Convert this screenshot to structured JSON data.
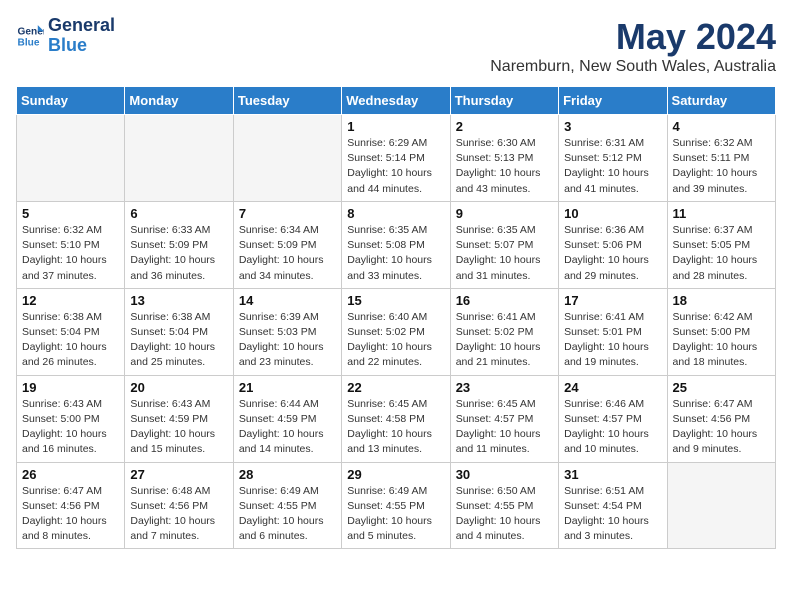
{
  "header": {
    "logo_line1": "General",
    "logo_line2": "Blue",
    "month_year": "May 2024",
    "location": "Naremburn, New South Wales, Australia"
  },
  "weekdays": [
    "Sunday",
    "Monday",
    "Tuesday",
    "Wednesday",
    "Thursday",
    "Friday",
    "Saturday"
  ],
  "weeks": [
    [
      {
        "day": "",
        "info": ""
      },
      {
        "day": "",
        "info": ""
      },
      {
        "day": "",
        "info": ""
      },
      {
        "day": "1",
        "info": "Sunrise: 6:29 AM\nSunset: 5:14 PM\nDaylight: 10 hours\nand 44 minutes."
      },
      {
        "day": "2",
        "info": "Sunrise: 6:30 AM\nSunset: 5:13 PM\nDaylight: 10 hours\nand 43 minutes."
      },
      {
        "day": "3",
        "info": "Sunrise: 6:31 AM\nSunset: 5:12 PM\nDaylight: 10 hours\nand 41 minutes."
      },
      {
        "day": "4",
        "info": "Sunrise: 6:32 AM\nSunset: 5:11 PM\nDaylight: 10 hours\nand 39 minutes."
      }
    ],
    [
      {
        "day": "5",
        "info": "Sunrise: 6:32 AM\nSunset: 5:10 PM\nDaylight: 10 hours\nand 37 minutes."
      },
      {
        "day": "6",
        "info": "Sunrise: 6:33 AM\nSunset: 5:09 PM\nDaylight: 10 hours\nand 36 minutes."
      },
      {
        "day": "7",
        "info": "Sunrise: 6:34 AM\nSunset: 5:09 PM\nDaylight: 10 hours\nand 34 minutes."
      },
      {
        "day": "8",
        "info": "Sunrise: 6:35 AM\nSunset: 5:08 PM\nDaylight: 10 hours\nand 33 minutes."
      },
      {
        "day": "9",
        "info": "Sunrise: 6:35 AM\nSunset: 5:07 PM\nDaylight: 10 hours\nand 31 minutes."
      },
      {
        "day": "10",
        "info": "Sunrise: 6:36 AM\nSunset: 5:06 PM\nDaylight: 10 hours\nand 29 minutes."
      },
      {
        "day": "11",
        "info": "Sunrise: 6:37 AM\nSunset: 5:05 PM\nDaylight: 10 hours\nand 28 minutes."
      }
    ],
    [
      {
        "day": "12",
        "info": "Sunrise: 6:38 AM\nSunset: 5:04 PM\nDaylight: 10 hours\nand 26 minutes."
      },
      {
        "day": "13",
        "info": "Sunrise: 6:38 AM\nSunset: 5:04 PM\nDaylight: 10 hours\nand 25 minutes."
      },
      {
        "day": "14",
        "info": "Sunrise: 6:39 AM\nSunset: 5:03 PM\nDaylight: 10 hours\nand 23 minutes."
      },
      {
        "day": "15",
        "info": "Sunrise: 6:40 AM\nSunset: 5:02 PM\nDaylight: 10 hours\nand 22 minutes."
      },
      {
        "day": "16",
        "info": "Sunrise: 6:41 AM\nSunset: 5:02 PM\nDaylight: 10 hours\nand 21 minutes."
      },
      {
        "day": "17",
        "info": "Sunrise: 6:41 AM\nSunset: 5:01 PM\nDaylight: 10 hours\nand 19 minutes."
      },
      {
        "day": "18",
        "info": "Sunrise: 6:42 AM\nSunset: 5:00 PM\nDaylight: 10 hours\nand 18 minutes."
      }
    ],
    [
      {
        "day": "19",
        "info": "Sunrise: 6:43 AM\nSunset: 5:00 PM\nDaylight: 10 hours\nand 16 minutes."
      },
      {
        "day": "20",
        "info": "Sunrise: 6:43 AM\nSunset: 4:59 PM\nDaylight: 10 hours\nand 15 minutes."
      },
      {
        "day": "21",
        "info": "Sunrise: 6:44 AM\nSunset: 4:59 PM\nDaylight: 10 hours\nand 14 minutes."
      },
      {
        "day": "22",
        "info": "Sunrise: 6:45 AM\nSunset: 4:58 PM\nDaylight: 10 hours\nand 13 minutes."
      },
      {
        "day": "23",
        "info": "Sunrise: 6:45 AM\nSunset: 4:57 PM\nDaylight: 10 hours\nand 11 minutes."
      },
      {
        "day": "24",
        "info": "Sunrise: 6:46 AM\nSunset: 4:57 PM\nDaylight: 10 hours\nand 10 minutes."
      },
      {
        "day": "25",
        "info": "Sunrise: 6:47 AM\nSunset: 4:56 PM\nDaylight: 10 hours\nand 9 minutes."
      }
    ],
    [
      {
        "day": "26",
        "info": "Sunrise: 6:47 AM\nSunset: 4:56 PM\nDaylight: 10 hours\nand 8 minutes."
      },
      {
        "day": "27",
        "info": "Sunrise: 6:48 AM\nSunset: 4:56 PM\nDaylight: 10 hours\nand 7 minutes."
      },
      {
        "day": "28",
        "info": "Sunrise: 6:49 AM\nSunset: 4:55 PM\nDaylight: 10 hours\nand 6 minutes."
      },
      {
        "day": "29",
        "info": "Sunrise: 6:49 AM\nSunset: 4:55 PM\nDaylight: 10 hours\nand 5 minutes."
      },
      {
        "day": "30",
        "info": "Sunrise: 6:50 AM\nSunset: 4:55 PM\nDaylight: 10 hours\nand 4 minutes."
      },
      {
        "day": "31",
        "info": "Sunrise: 6:51 AM\nSunset: 4:54 PM\nDaylight: 10 hours\nand 3 minutes."
      },
      {
        "day": "",
        "info": ""
      }
    ]
  ]
}
